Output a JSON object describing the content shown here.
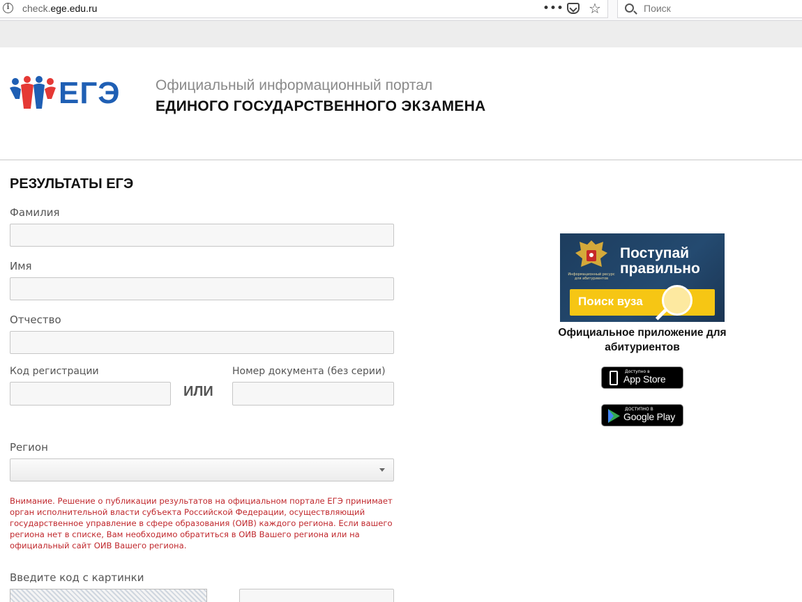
{
  "browser": {
    "info_glyph": "i",
    "url_prefix": "check.",
    "url_domain": "ege.edu.ru",
    "page_actions_glyph": "•••",
    "bookmark_glyph": "☆",
    "search_placeholder": "Поиск"
  },
  "header": {
    "logo_text": "ЕГЭ",
    "subtitle": "Официальный информационный портал",
    "title": "ЕДИНОГО ГОСУДАРСТВЕННОГО ЭКЗАМЕНА"
  },
  "form": {
    "page_title": "РЕЗУЛЬТАТЫ ЕГЭ",
    "surname_label": "Фамилия",
    "surname_value": "",
    "name_label": "Имя",
    "name_value": "",
    "patronymic_label": "Отчество",
    "patronymic_value": "",
    "reg_code_label": "Код регистрации",
    "reg_code_value": "",
    "or_text": "ИЛИ",
    "doc_number_label": "Номер документа (без серии)",
    "doc_number_value": "",
    "region_label": "Регион",
    "region_value": "",
    "warning_text": "Внимание. Решение о публикации результатов на официальном портале ЕГЭ принимает орган исполнительной власти субъекта Российской Федерации, осуществляющий государственное управление в сфере образования (ОИВ) каждого региона. Если вашего региона нет в списке, Вам необходимо обратиться в ОИВ Вашего региона или на официальный сайт ОИВ Вашего региона.",
    "captcha_label": "Введите код с картинки",
    "captcha_value": ""
  },
  "promo": {
    "emblem_caption": "Информационный ресурс для абитуриентов",
    "banner_title": "Поступай правильно",
    "banner_button": "Поиск вуза",
    "app_caption": "Официальное приложение для абитуриентов",
    "appstore_small": "Доступно в",
    "appstore_big": "App Store",
    "googleplay_small": "ДОСТУПНО В",
    "googleplay_big": "Google Play"
  },
  "colors": {
    "warning_red": "#c0282d",
    "logo_blue": "#1f5fb4",
    "banner_navy": "#244a70",
    "banner_yellow": "#f6c614"
  }
}
